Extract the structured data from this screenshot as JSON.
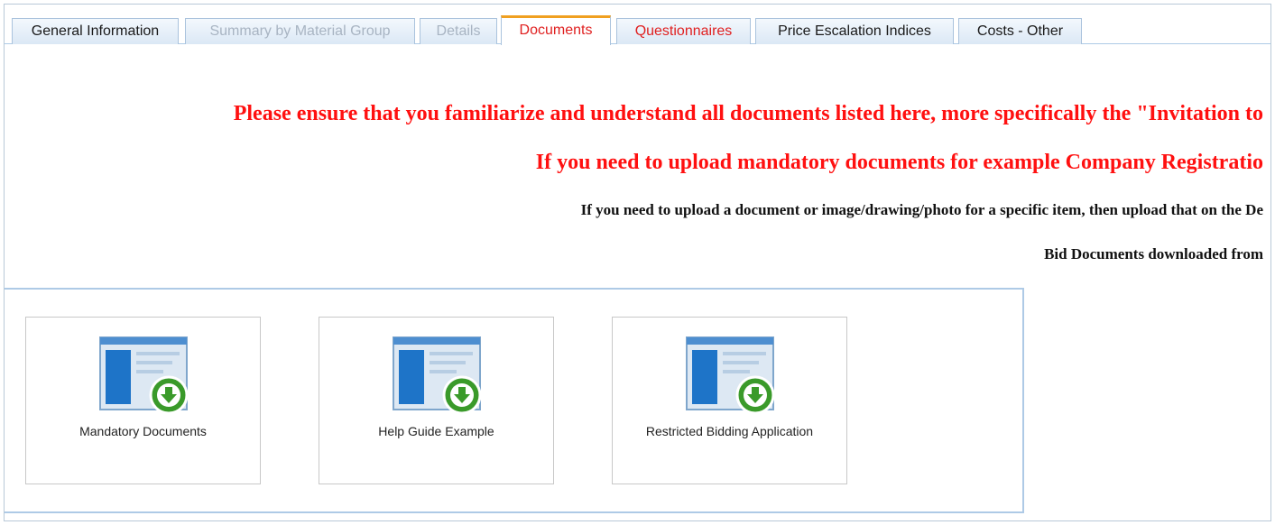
{
  "tabs": [
    {
      "label": "General Information",
      "state": "normal"
    },
    {
      "label": "Summary by Material Group",
      "state": "disabled"
    },
    {
      "label": "Details",
      "state": "disabled"
    },
    {
      "label": "Documents",
      "state": "active"
    },
    {
      "label": "Questionnaires",
      "state": "warning"
    },
    {
      "label": "Price Escalation Indices",
      "state": "normal"
    },
    {
      "label": "Costs - Other",
      "state": "normal"
    }
  ],
  "notices": [
    "Please ensure that you familiarize and understand all documents listed here, more specifically the \"Invitation to",
    "If you need to upload mandatory documents for example Company Registratio",
    "If you need to upload a document or image/drawing/photo for a specific item, then upload that on the De",
    "Bid Documents downloaded from"
  ],
  "documents": [
    {
      "label": "Mandatory Documents",
      "icon": "download-document-icon"
    },
    {
      "label": "Help Guide Example",
      "icon": "download-document-icon"
    },
    {
      "label": "Restricted Bidding Application",
      "icon": "download-document-icon"
    }
  ],
  "colors": {
    "active_tab_text": "#e02020",
    "active_tab_accent": "#f0a020",
    "notice_red": "#ff1010",
    "download_badge": "#3a9a2a"
  }
}
